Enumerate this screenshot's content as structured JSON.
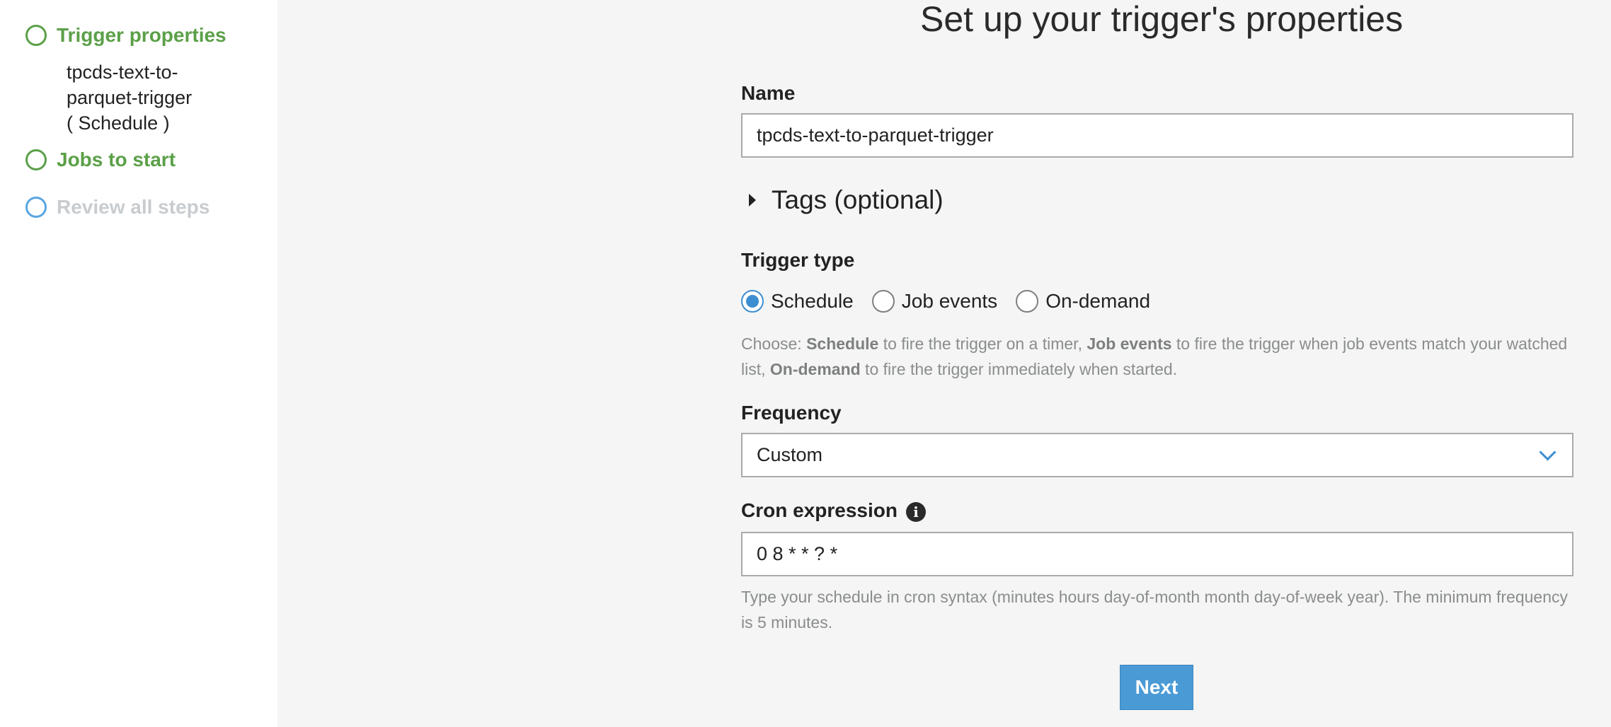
{
  "sidebar": {
    "steps": [
      {
        "label": "Trigger properties",
        "state": "active",
        "detail": [
          "tpcds-text-to-",
          "parquet-trigger",
          "( Schedule )"
        ]
      },
      {
        "label": "Jobs to start",
        "state": "active"
      },
      {
        "label": "Review all steps",
        "state": "pending"
      }
    ]
  },
  "page": {
    "title": "Set up your trigger's properties"
  },
  "form": {
    "name": {
      "label": "Name",
      "value": "tpcds-text-to-parquet-trigger"
    },
    "tags": {
      "label": "Tags (optional)",
      "expanded": false
    },
    "trigger_type": {
      "label": "Trigger type",
      "options": [
        {
          "label": "Schedule",
          "checked": true
        },
        {
          "label": "Job events",
          "checked": false
        },
        {
          "label": "On-demand",
          "checked": false
        }
      ],
      "help": {
        "prefix": "Choose: ",
        "schedule_bold": "Schedule",
        "schedule_rest": " to fire the trigger on a timer, ",
        "job_events_bold": "Job events",
        "job_events_rest": " to fire the trigger when job events match your watched list, ",
        "on_demand_bold": "On-demand",
        "on_demand_rest": " to fire the trigger immediately when started."
      }
    },
    "frequency": {
      "label": "Frequency",
      "selected": "Custom"
    },
    "cron": {
      "label": "Cron expression",
      "value": "0 8 * * ? *",
      "help": "Type your schedule in cron syntax (minutes hours day-of-month month day-of-week year). The minimum frequency is 5 minutes."
    },
    "next_label": "Next"
  },
  "colors": {
    "step_active": "#5ba048",
    "step_pending_circle": "#59a6e0",
    "step_pending_text": "#c8cccf",
    "primary_button": "#4a9ad6",
    "radio_selected": "#3d8ed1"
  },
  "icons": {
    "info": "info-icon",
    "caret": "caret-right-icon",
    "select": "chevron-down-icon",
    "step": "step-circle-icon"
  }
}
